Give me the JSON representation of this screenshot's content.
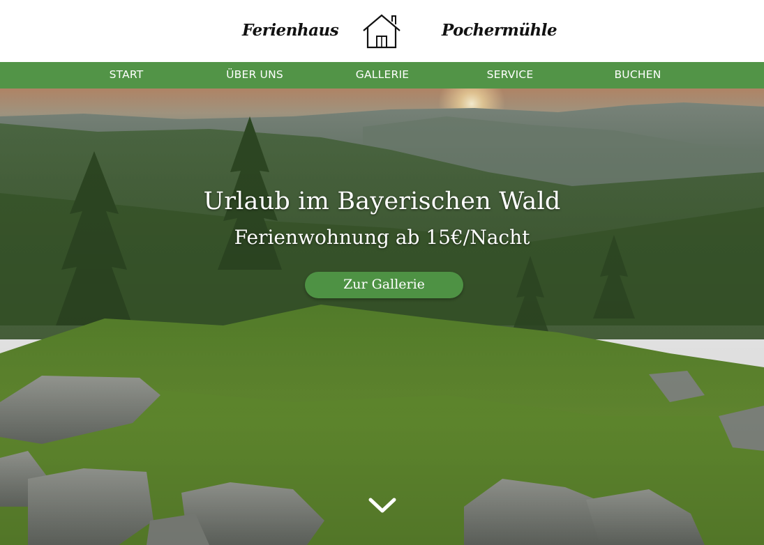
{
  "header": {
    "brand_left": "Ferienhaus",
    "brand_right": "Pochermühle",
    "logo_icon": "house-icon"
  },
  "nav": {
    "items": [
      {
        "label": "START"
      },
      {
        "label": "ÜBER UNS"
      },
      {
        "label": "GALLERIE"
      },
      {
        "label": "SERVICE"
      },
      {
        "label": "BUCHEN"
      }
    ],
    "background": "#529447"
  },
  "hero": {
    "title": "Urlaub im Bayerischen Wald",
    "subtitle": "Ferienwohnung ab 15€/Nacht",
    "cta_label": "Zur Gallerie",
    "cta_color": "#4e9244",
    "scroll_icon": "chevron-down-icon"
  }
}
